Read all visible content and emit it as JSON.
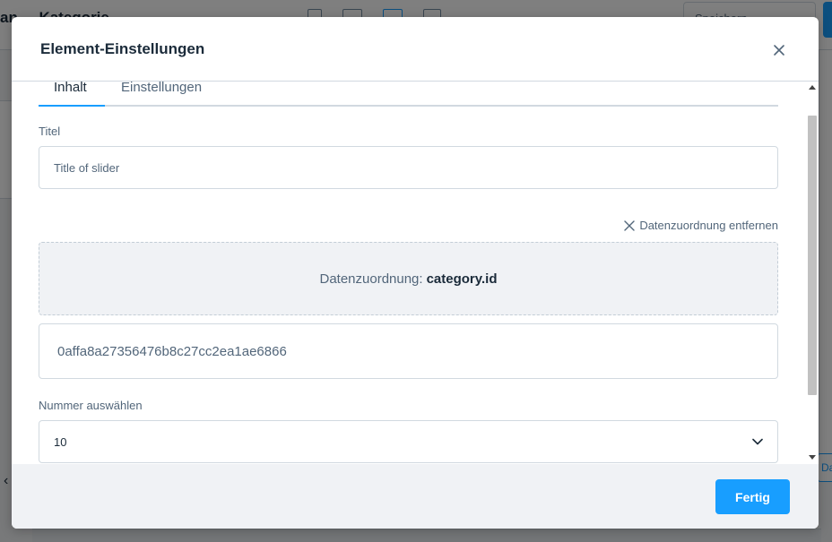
{
  "background": {
    "title": "an ... Kategorie ...",
    "button_label": "Speichern",
    "right_button_label": "Da"
  },
  "modal": {
    "title": "Element-Einstellungen",
    "close_icon": "close-icon",
    "tabs": [
      {
        "label": "Inhalt",
        "active": true
      },
      {
        "label": "Einstellungen",
        "active": false
      }
    ],
    "title_field": {
      "label": "Titel",
      "value": "Title of slider"
    },
    "remove_mapping_label": "Datenzuordnung entfernen",
    "mapping": {
      "prefix": "Datenzuordnung:",
      "value": "category.id"
    },
    "id_field": {
      "value": "0affa8a27356476b8c27cc2ea1ae6866"
    },
    "number_select": {
      "label": "Nummer auswählen",
      "value": "10"
    },
    "done_button_label": "Fertig"
  },
  "colors": {
    "accent": "#189eff",
    "text_dark": "#1b2b3a",
    "text_muted": "#52667a",
    "border": "#d1d9e0",
    "footer_bg": "#f0f2f5"
  }
}
